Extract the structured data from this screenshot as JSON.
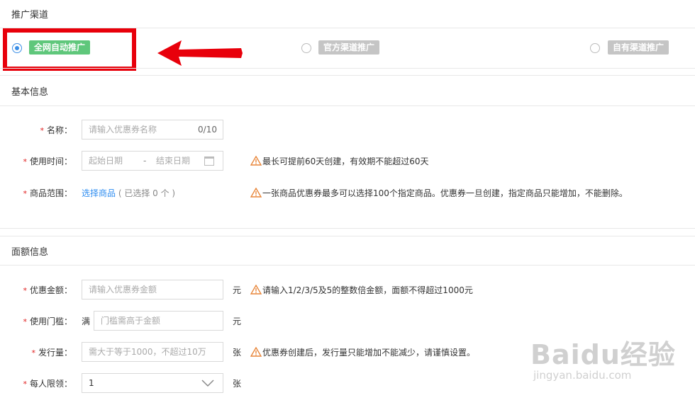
{
  "sections": {
    "channel_title": "推广渠道",
    "basic_title": "基本信息",
    "value_title": "面额信息"
  },
  "channels": [
    {
      "label": "全网自动推广",
      "selected": true,
      "color": "#5fc77b"
    },
    {
      "label": "官方渠道推广",
      "selected": false,
      "color": "#c5c5c5"
    },
    {
      "label": "自有渠道推广",
      "selected": false,
      "color": "#c5c5c5"
    }
  ],
  "form": {
    "required_mark": "*",
    "name": {
      "label": "名称：",
      "placeholder": "请输入优惠券名称",
      "count": "0/10"
    },
    "time": {
      "label": "使用时间：",
      "start": "起始日期",
      "sep": "-",
      "end": "结束日期",
      "hint": "最长可提前60天创建，有效期不能超过60天"
    },
    "scope": {
      "label": "商品范围：",
      "link": "选择商品",
      "selected_text": "( 已选择 0 个 )",
      "hint": "一张商品优惠券最多可以选择100个指定商品。优惠券一旦创建，指定商品只能增加，不能删除。"
    },
    "amount": {
      "label": "优惠金额：",
      "placeholder": "请输入优惠券金额",
      "unit": "元",
      "hint": "请输入1/2/3/5及5的整数倍金额，面额不得超过1000元"
    },
    "threshold": {
      "label": "使用门槛：",
      "prefix": "满",
      "placeholder": "门槛需高于金额",
      "unit": "元"
    },
    "quantity": {
      "label": "发行量：",
      "placeholder": "需大于等于1000，不超过10万",
      "unit": "张",
      "hint": "优惠券创建后，发行量只能增加不能减少，请谨慎设置。"
    },
    "limit": {
      "label": "每人限领：",
      "value": "1",
      "unit": "张"
    }
  },
  "watermark": {
    "main": "Baidu经验",
    "sub": "jingyan.baidu.com"
  },
  "colors": {
    "accent": "#3a8ee6",
    "required": "#e02020",
    "highlight": "#e8000b",
    "link": "#2d8cf0",
    "warning": "#e8863a"
  }
}
